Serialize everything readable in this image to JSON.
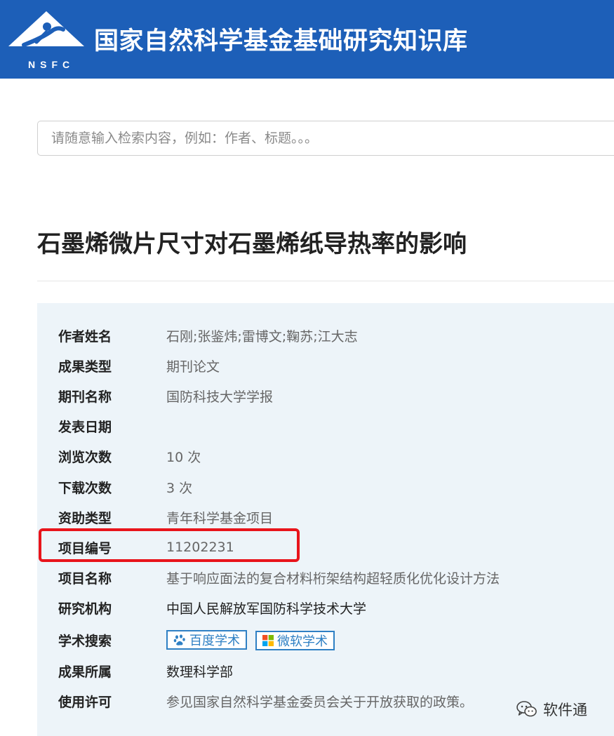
{
  "header": {
    "logo_text": "NSFC",
    "site_title": "国家自然科学基金基础研究知识库"
  },
  "search": {
    "placeholder": "请随意输入检索内容，例如：作者、标题。。。"
  },
  "paper": {
    "title": "石墨烯微片尺寸对石墨烯纸导热率的影响"
  },
  "details": [
    {
      "label": "作者姓名",
      "value": "石刚;张鉴炜;雷博文;鞠苏;江大志"
    },
    {
      "label": "成果类型",
      "value": "期刊论文"
    },
    {
      "label": "期刊名称",
      "value": "国防科技大学学报"
    },
    {
      "label": "发表日期",
      "value": ""
    },
    {
      "label": "浏览次数",
      "value": "10 次"
    },
    {
      "label": "下载次数",
      "value": "3 次"
    },
    {
      "label": "资助类型",
      "value": "青年科学基金项目"
    },
    {
      "label": "项目编号",
      "value": "11202231"
    },
    {
      "label": "项目名称",
      "value": "基于响应面法的复合材料桁架结构超轻质化优化设计方法"
    },
    {
      "label": "研究机构",
      "value": "中国人民解放军国防科学技术大学"
    },
    {
      "label": "学术搜索",
      "value": ""
    },
    {
      "label": "成果所属",
      "value": "数理科学部"
    },
    {
      "label": "使用许可",
      "value": "参见国家自然科学基金委员会关于开放获取的政策。"
    }
  ],
  "academic_search": {
    "baidu_label": "百度学术",
    "microsoft_label": "微软学术"
  },
  "watermark": {
    "text": "软件通"
  },
  "colors": {
    "header_bg": "#1d5fb8",
    "panel_bg": "#edf4f9",
    "highlight": "#e8141b",
    "link_blue": "#2f80c4"
  },
  "icons": {
    "logo": "nsfc-logo",
    "baidu": "baidu-paw-icon",
    "microsoft": "microsoft-windows-icon",
    "wechat": "wechat-icon"
  }
}
